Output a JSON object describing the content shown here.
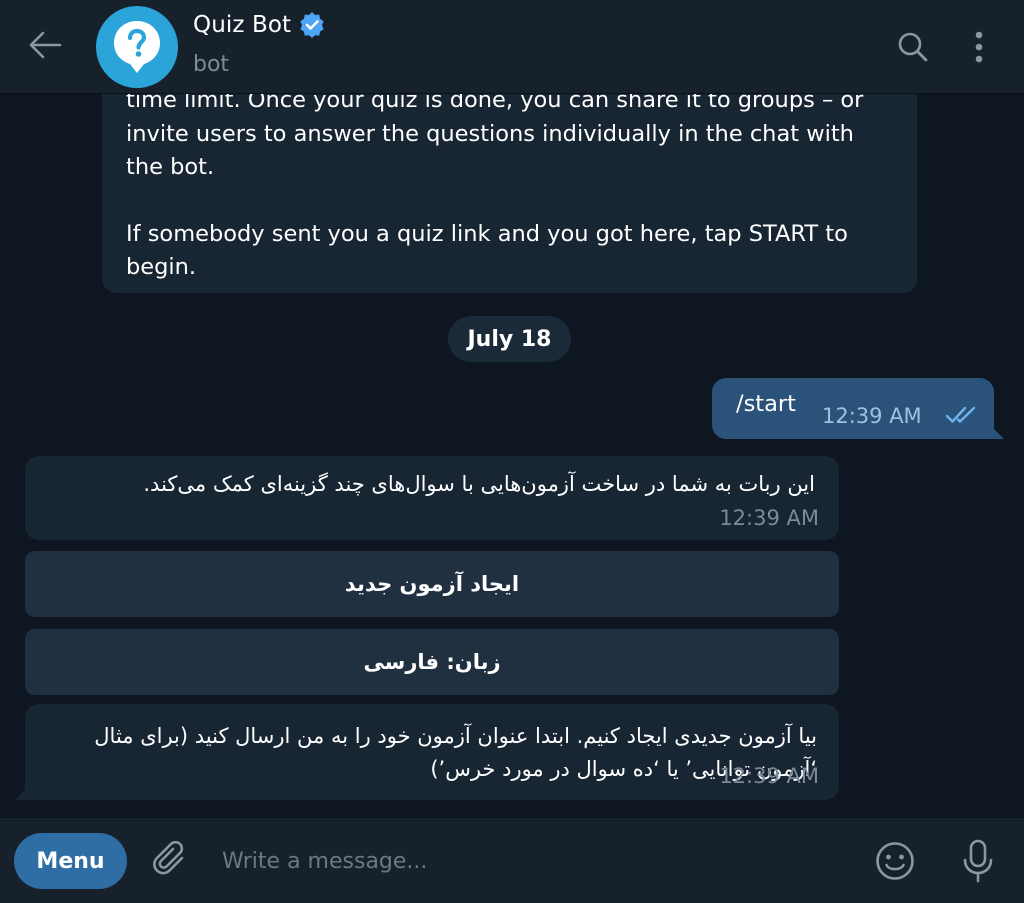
{
  "header": {
    "title": "Quiz Bot",
    "subtitle": "bot",
    "avatar_icon": "question-bubble-icon",
    "verified_icon": "verified-badge-icon",
    "back_icon": "arrow-left-icon",
    "search_icon": "search-icon",
    "more_icon": "kebab-menu-icon"
  },
  "messages": {
    "intro": {
      "line_partial": "time limit. Once your quiz is done, you can share it to groups – or",
      "line_rest": "invite users to answer the questions individually in the chat with the bot.",
      "paragraph2": "If somebody sent you a quiz link and you got here, tap START to begin."
    },
    "date_separator": "July 18",
    "outgoing": {
      "text": "/start",
      "time": "12:39 AM",
      "status_icon": "double-check-icon"
    },
    "bot_reply_1": {
      "text": "این ربات به شما در ساخت آزمون‌هایی با سوال‌های چند گزینه‌ای کمک می‌کند.",
      "time": "12:39 AM"
    },
    "keyboard": [
      {
        "label": "ایجاد آزمون جدید"
      },
      {
        "label": "زبان: فارسی"
      }
    ],
    "bot_reply_2": {
      "text": "بیا آزمون جدیدی ایجاد کنیم. ابتدا عنوان آزمون خود را به من ارسال کنید (برای مثال ‘آزمون توانایی’ یا ‘ده سوال در مورد خرس’)",
      "time": "12:39 AM"
    }
  },
  "input_bar": {
    "menu_label": "Menu",
    "placeholder": "Write a message...",
    "attach_icon": "paperclip-icon",
    "emoji_icon": "smile-icon",
    "mic_icon": "microphone-icon"
  },
  "colors": {
    "background": "#0e1621",
    "header": "#17212b",
    "incoming_bubble": "#182533",
    "outgoing_bubble": "#2b5278",
    "accent": "#2f6ea5",
    "avatar": "#2ba5d9",
    "muted_text": "#7d8b99"
  }
}
